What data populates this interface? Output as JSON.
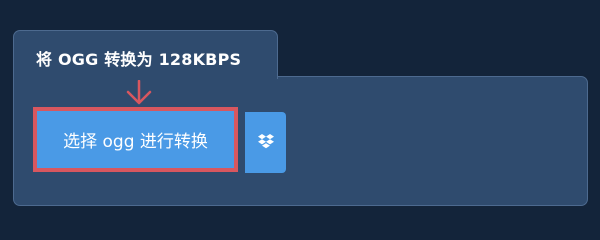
{
  "converter": {
    "tab_title": "将 OGG 转换为 128KBPS",
    "choose_button_label": "选择 ogg 进行转换",
    "dropbox_icon": "dropbox-icon",
    "pointer_icon": "arrow-down-icon"
  },
  "colors": {
    "background": "#13243a",
    "panel": "#2f4b6e",
    "panel_border": "#4d6a8f",
    "button": "#4a9ae6",
    "highlight": "#d8575f",
    "text": "#ffffff"
  }
}
